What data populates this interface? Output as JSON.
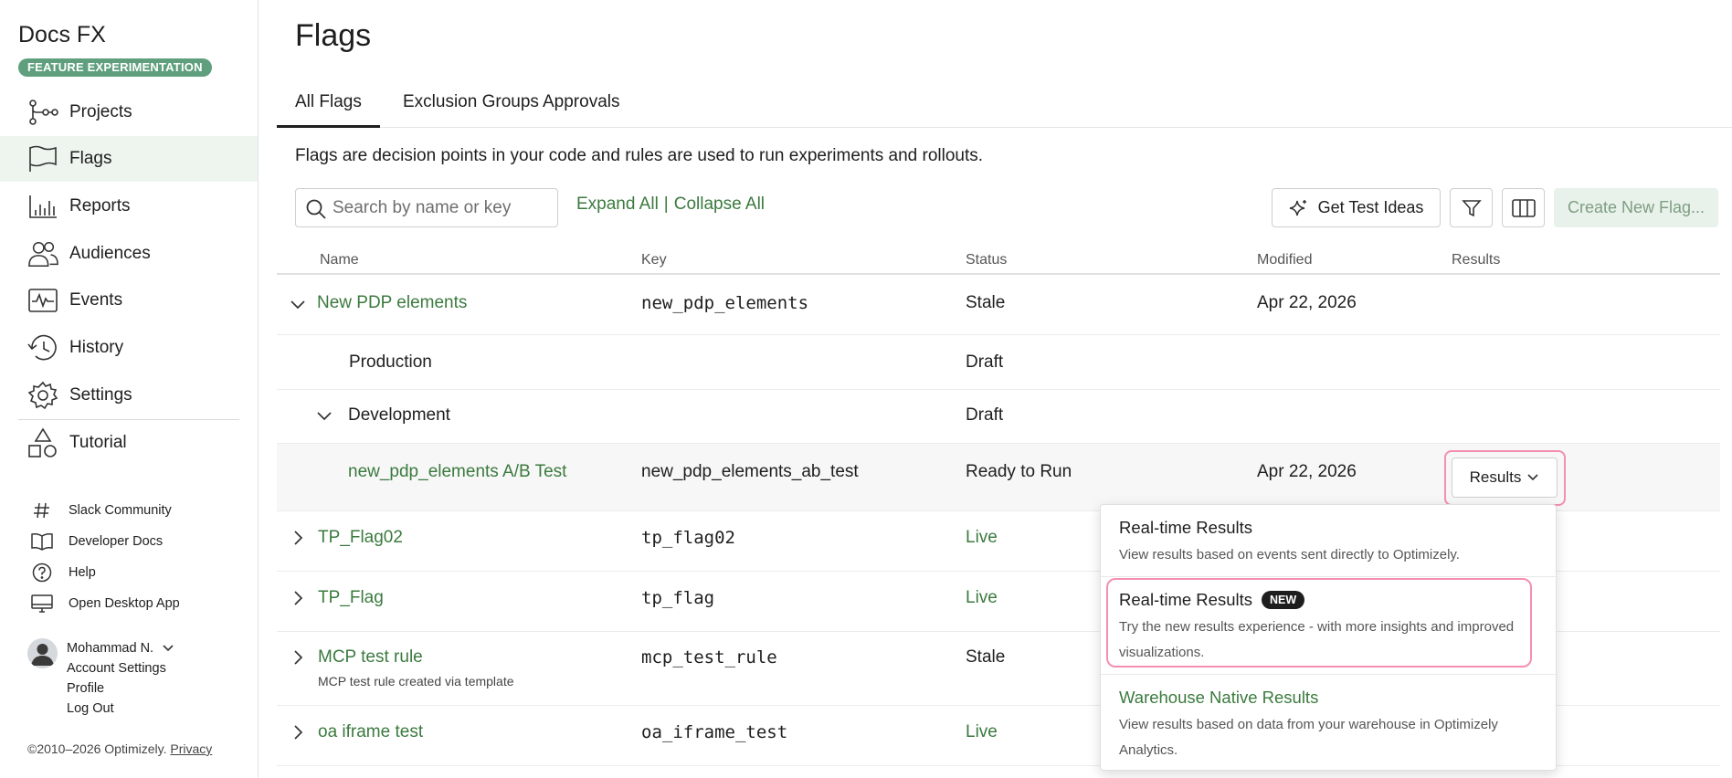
{
  "sidebar": {
    "app_title": "Docs FX",
    "app_badge": "FEATURE EXPERIMENTATION",
    "nav": [
      {
        "label": "Projects",
        "icon": "projects-icon"
      },
      {
        "label": "Flags",
        "icon": "flag-icon",
        "active": true
      },
      {
        "label": "Reports",
        "icon": "reports-icon"
      },
      {
        "label": "Audiences",
        "icon": "audiences-icon"
      },
      {
        "label": "Events",
        "icon": "events-icon"
      },
      {
        "label": "History",
        "icon": "history-icon"
      },
      {
        "label": "Settings",
        "icon": "gear-icon"
      },
      {
        "label": "Tutorial",
        "icon": "tutorial-icon"
      }
    ],
    "links": [
      {
        "label": "Slack Community",
        "icon": "hash-icon"
      },
      {
        "label": "Developer Docs",
        "icon": "book-icon"
      },
      {
        "label": "Help",
        "icon": "help-icon"
      },
      {
        "label": "Open Desktop App",
        "icon": "desktop-icon"
      }
    ],
    "user": {
      "name": "Mohammad N.",
      "account_settings": "Account Settings",
      "profile": "Profile",
      "logout": "Log Out"
    },
    "copyright": "©2010–2026 Optimizely.",
    "privacy": "Privacy"
  },
  "main": {
    "title": "Flags",
    "tabs": [
      {
        "label": "All Flags",
        "active": true
      },
      {
        "label": "Exclusion Groups"
      },
      {
        "label": "Approvals"
      }
    ],
    "description": "Flags are decision points in your code and rules are used to run experiments and rollouts.",
    "search_placeholder": "Search by name or key",
    "expand_all": "Expand All",
    "collapse_all": "Collapse All",
    "separator": "|",
    "get_test_ideas": "Get Test Ideas",
    "create_new_flag": "Create New Flag..."
  },
  "table": {
    "headers": {
      "name": "Name",
      "key": "Key",
      "status": "Status",
      "modified": "Modified",
      "results": "Results"
    },
    "rows": [
      {
        "name": "New PDP elements",
        "key": "new_pdp_elements",
        "status": "Stale",
        "modified": "Apr 22, 2026"
      },
      {
        "name": "Production",
        "status": "Draft"
      },
      {
        "name": "Development",
        "status": "Draft"
      },
      {
        "name": "new_pdp_elements A/B Test",
        "key": "new_pdp_elements_ab_test",
        "status": "Ready to Run",
        "modified": "Apr 22, 2026",
        "results": "Results"
      },
      {
        "name": "TP_Flag02",
        "key": "tp_flag02",
        "status": "Live"
      },
      {
        "name": "TP_Flag",
        "key": "tp_flag",
        "status": "Live"
      },
      {
        "name": "MCP test rule",
        "subtitle": "MCP test rule created via template",
        "key": "mcp_test_rule",
        "status": "Stale"
      },
      {
        "name": "oa iframe test",
        "key": "oa_iframe_test",
        "status": "Live"
      }
    ]
  },
  "dropdown": {
    "items": [
      {
        "title": "Real-time Results",
        "desc": "View results based on events sent directly to Optimizely."
      },
      {
        "title": "Real-time Results",
        "badge": "NEW",
        "desc": "Try the new results experience - with more insights and improved visualizations."
      },
      {
        "title": "Warehouse Native Results",
        "desc": "View results based on data from your warehouse in Optimizely Analytics."
      }
    ]
  },
  "colors": {
    "accent_green": "#3b7a3e",
    "badge_green": "#5f9f7e",
    "active_nav_bg": "#edf5ee",
    "highlight_pink": "#f48fb1"
  }
}
